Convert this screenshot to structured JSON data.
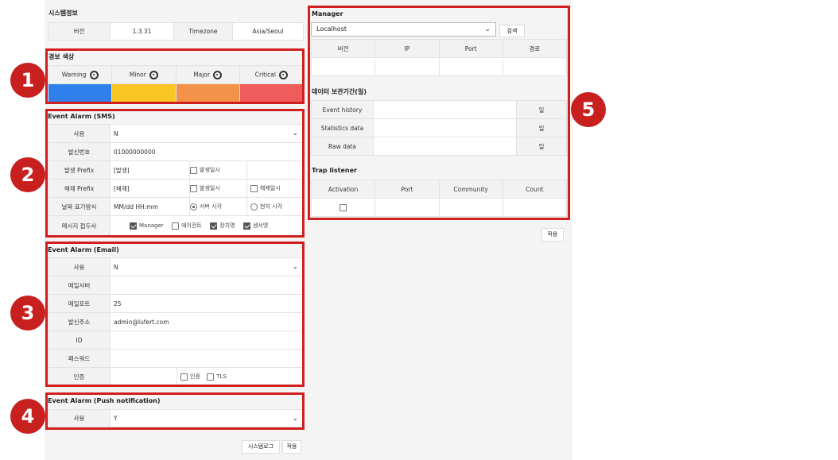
{
  "system_info": {
    "title": "시스템정보",
    "version_label": "버전",
    "version_value": "1.3.31",
    "timezone_label": "Timezone",
    "timezone_value": "Asia/Seoul"
  },
  "alarm_color": {
    "title": "경보 색상",
    "levels": [
      {
        "label": "Warning",
        "color": "#2f80ed"
      },
      {
        "label": "Minor",
        "color": "#f9c623"
      },
      {
        "label": "Major",
        "color": "#f4924a"
      },
      {
        "label": "Critical",
        "color": "#f05b5b"
      }
    ]
  },
  "sms": {
    "title": "Event Alarm (SMS)",
    "use_label": "사용",
    "use_value": "N",
    "sender_label": "발신번호",
    "sender_value": "01000000000",
    "occur_prefix_label": "발생 Prefix",
    "occur_prefix_value": "[발생]",
    "occur_time_opt": "발생일시",
    "clear_prefix_label": "해제 Prefix",
    "clear_prefix_value": "[해제]",
    "clear_occur_opt": "발생일시",
    "clear_time_opt": "해제일시",
    "date_format_label": "날짜 표기방식",
    "date_format_value": "MM/dd HH:mm",
    "server_time_opt": "서버 시각",
    "local_time_opt": "현지 시각",
    "msg_prefix_label": "메시지 접두사",
    "msg_opt_manager": "Manager",
    "msg_opt_agent": "에이전트",
    "msg_opt_device": "장치명",
    "msg_opt_sensor": "센서명"
  },
  "email": {
    "title": "Event Alarm (Email)",
    "use_label": "사용",
    "use_value": "N",
    "server_label": "메일서버",
    "server_value": "",
    "port_label": "메일포트",
    "port_value": "25",
    "sender_label": "발신주소",
    "sender_value": "admin@lufert.com",
    "id_label": "ID",
    "id_value": "",
    "password_label": "패스워드",
    "password_value": "",
    "auth_label": "인증",
    "auth_opt": "인증",
    "tls_opt": "TLS"
  },
  "push": {
    "title": "Event Alarm (Push notification)",
    "use_label": "사용",
    "use_value": "Y"
  },
  "bottom_buttons": {
    "syslog": "시스템로그",
    "apply": "적용"
  },
  "manager": {
    "title": "Manager",
    "select_value": "Localhost",
    "search_button": "검색",
    "columns": [
      "버전",
      "IP",
      "Port",
      "경로"
    ]
  },
  "retention": {
    "title": "데이터 보관기간(일)",
    "rows": [
      {
        "label": "Event history",
        "unit": "일"
      },
      {
        "label": "Statistics data",
        "unit": "일"
      },
      {
        "label": "Raw data",
        "unit": "일"
      }
    ]
  },
  "trap": {
    "title": "Trap listener",
    "columns": [
      "Activation",
      "Port",
      "Community",
      "Count"
    ]
  },
  "right_apply": "적용",
  "badges": [
    "1",
    "2",
    "3",
    "4",
    "5"
  ]
}
